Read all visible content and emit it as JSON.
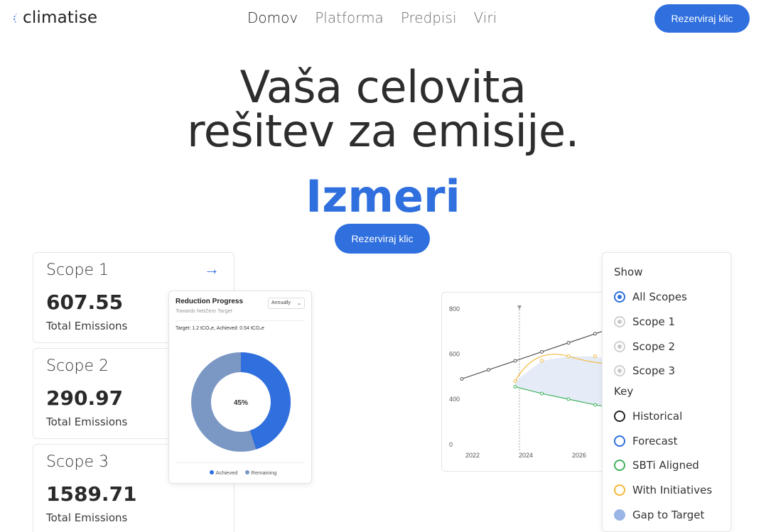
{
  "header": {
    "logo": "climatise",
    "nav": [
      "Domov",
      "Platforma",
      "Predpisi",
      "Viri"
    ],
    "cta": "Rezerviraj klic"
  },
  "hero": {
    "title_line1": "Vaša celovita",
    "title_line2": "rešitev za emisije.",
    "highlight": "Izmeri",
    "cta": "Rezerviraj klic"
  },
  "scopes": [
    {
      "title": "Scope 1",
      "value": "607.55",
      "label": "Total Emissions"
    },
    {
      "title": "Scope 2",
      "value": "290.97",
      "label": "Total Emissions"
    },
    {
      "title": "Scope 3",
      "value": "1589.71",
      "label": "Total Emissions"
    }
  ],
  "reduction": {
    "title": "Reduction Progress",
    "subtitle": "Towards NetZero Target",
    "select": "Annually",
    "target_text": "Target: 1.2 tCO₂e, Achieved: 0.54 tCO₂e",
    "center_label": "45%",
    "legend_achieved": "Achieved",
    "legend_remaining": "Remaining",
    "colors": {
      "achieved": "#2f6fde",
      "remaining": "#7b97c4"
    }
  },
  "chart_data": {
    "type": "line",
    "x_ticks": [
      "2022",
      "2024",
      "2026"
    ],
    "y_ticks": [
      "800",
      "600",
      "400",
      "0"
    ],
    "series": [
      {
        "name": "Historical",
        "color": "#555555",
        "points": [
          [
            2021.6,
            490
          ],
          [
            2022.6,
            530
          ],
          [
            2023.6,
            570
          ],
          [
            2024.6,
            610
          ],
          [
            2025.6,
            650
          ],
          [
            2026.6,
            690
          ],
          [
            2027.6,
            730
          ]
        ]
      },
      {
        "name": "With Initiatives",
        "color": "#f2b93b",
        "points": [
          [
            2023.6,
            480
          ],
          [
            2024.6,
            570
          ],
          [
            2025.6,
            590
          ],
          [
            2026.6,
            590
          ],
          [
            2027.6,
            560
          ]
        ]
      },
      {
        "name": "SBTi Aligned",
        "color": "#3fb25c",
        "points": [
          [
            2023.6,
            455
          ],
          [
            2024.6,
            425
          ],
          [
            2025.6,
            400
          ],
          [
            2026.6,
            375
          ],
          [
            2027.6,
            355
          ]
        ]
      }
    ],
    "marker_x": "2024"
  },
  "show_panel": {
    "show_heading": "Show",
    "scope_options": [
      {
        "label": "All Scopes",
        "selected": true
      },
      {
        "label": "Scope 1",
        "selected": false
      },
      {
        "label": "Scope 2",
        "selected": false
      },
      {
        "label": "Scope 3",
        "selected": false
      }
    ],
    "key_heading": "Key",
    "key_items": [
      {
        "label": "Historical",
        "color": "#222222",
        "filled": false
      },
      {
        "label": "Forecast",
        "color": "#2f6fde",
        "filled": false
      },
      {
        "label": "SBTi Aligned",
        "color": "#3fb25c",
        "filled": false
      },
      {
        "label": "With Initiatives",
        "color": "#f2b93b",
        "filled": false
      },
      {
        "label": "Gap to Target",
        "color": "#9bb5e6",
        "filled": true
      }
    ]
  }
}
